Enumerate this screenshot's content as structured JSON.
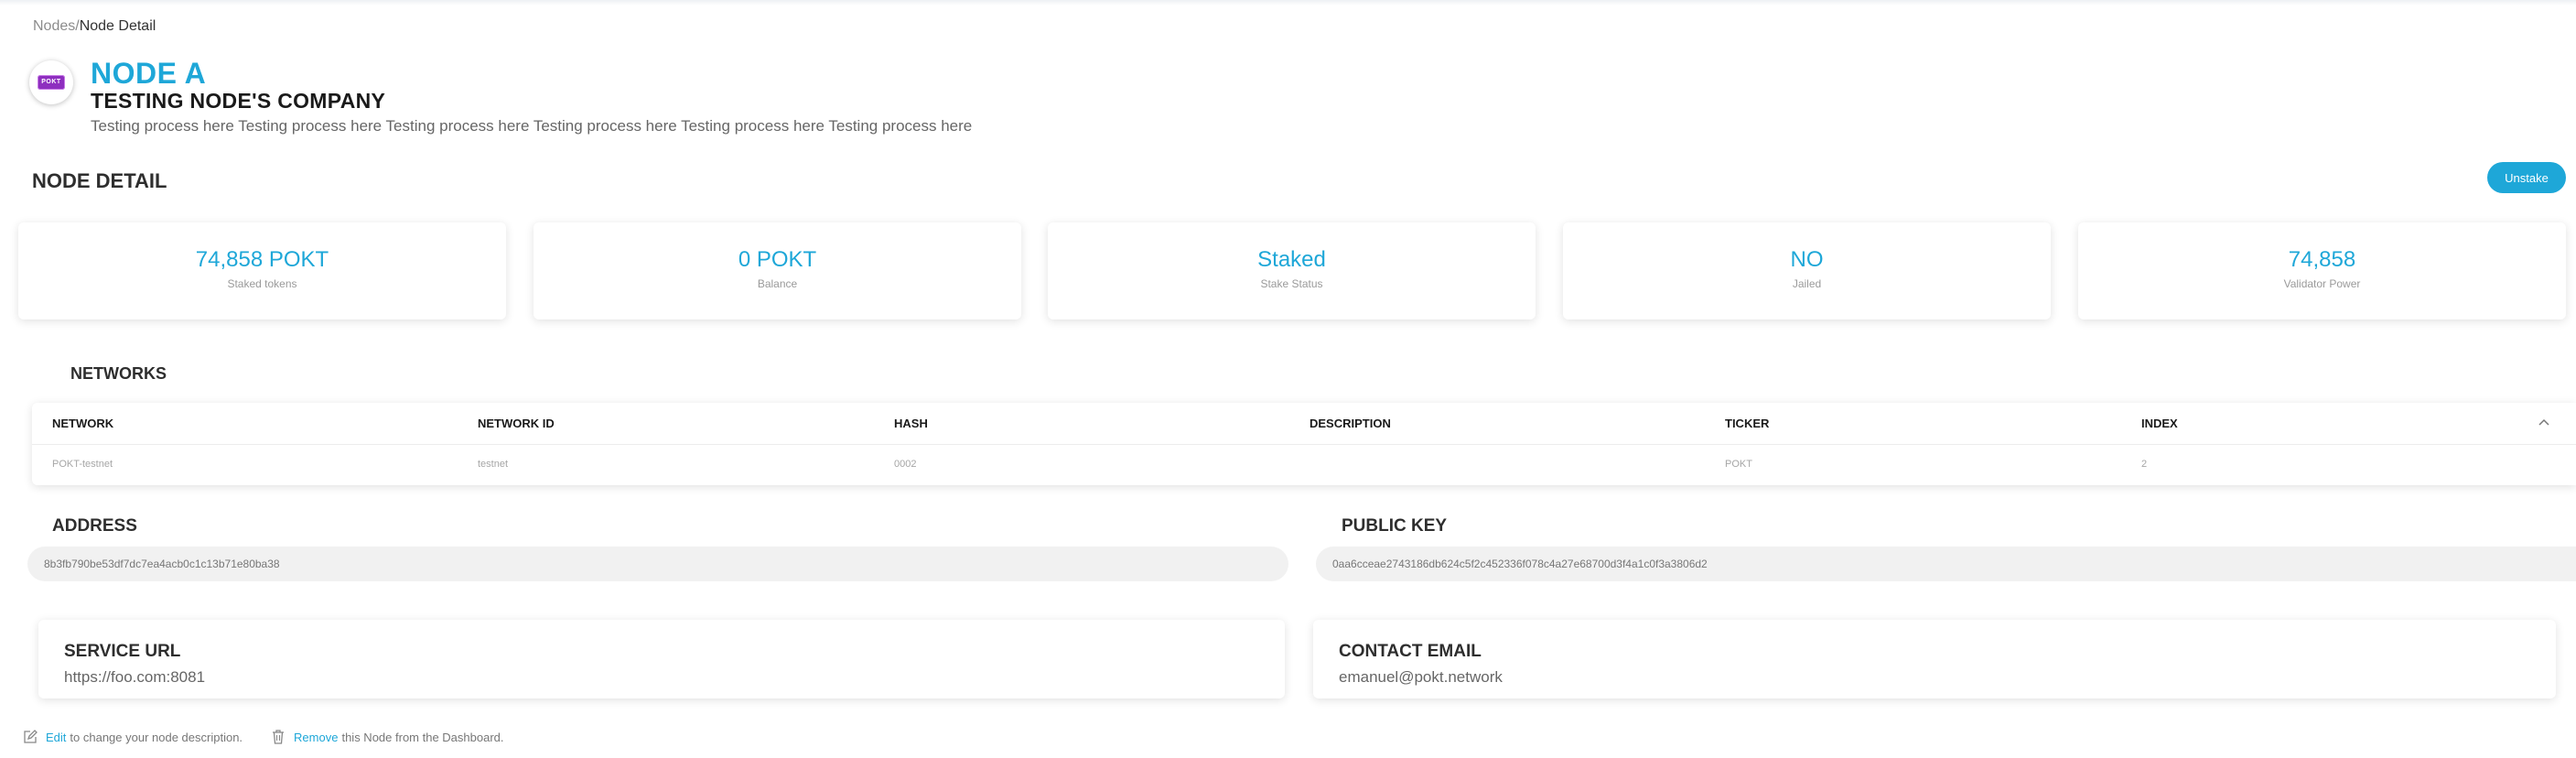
{
  "breadcrumb": {
    "root": "Nodes",
    "separator": "/",
    "current": "Node Detail"
  },
  "node": {
    "name": "NODE A",
    "company": "TESTING NODE'S COMPANY",
    "description": "Testing process here Testing process here Testing process here Testing process here Testing process here Testing process here",
    "logo_text": "POKT"
  },
  "detail": {
    "title": "NODE DETAIL",
    "unstake_label": "Unstake"
  },
  "stats": [
    {
      "value": "74,858 POKT",
      "label": "Staked tokens"
    },
    {
      "value": "0 POKT",
      "label": "Balance"
    },
    {
      "value": "Staked",
      "label": "Stake Status"
    },
    {
      "value": "NO",
      "label": "Jailed"
    },
    {
      "value": "74,858",
      "label": "Validator Power"
    }
  ],
  "networks": {
    "title": "NETWORKS",
    "columns": [
      "NETWORK",
      "NETWORK ID",
      "HASH",
      "DESCRIPTION",
      "TICKER",
      "INDEX"
    ],
    "rows": [
      [
        "POKT-testnet",
        "testnet",
        "0002",
        "",
        "POKT",
        "2"
      ]
    ],
    "collapse_icon": "chevron-up-icon"
  },
  "address": {
    "title": "ADDRESS",
    "value": "8b3fb790be53df7dc7ea4acb0c1c13b71e80ba38"
  },
  "public_key": {
    "title": "PUBLIC KEY",
    "value": "0aa6cceae2743186db624c5f2c452336f078c4a27e68700d3f4a1c0f3a3806d2"
  },
  "service_url": {
    "title": "SERVICE URL",
    "value": "https://foo.com:8081"
  },
  "contact_email": {
    "title": "CONTACT EMAIL",
    "value": "emanuel@pokt.network"
  },
  "footer": {
    "edit_link": "Edit",
    "edit_text": "to change your node description.",
    "remove_link": "Remove",
    "remove_text": "this Node from the Dashboard."
  },
  "colors": {
    "accent": "#1ea7d8",
    "logo": "#8e2fbf"
  }
}
